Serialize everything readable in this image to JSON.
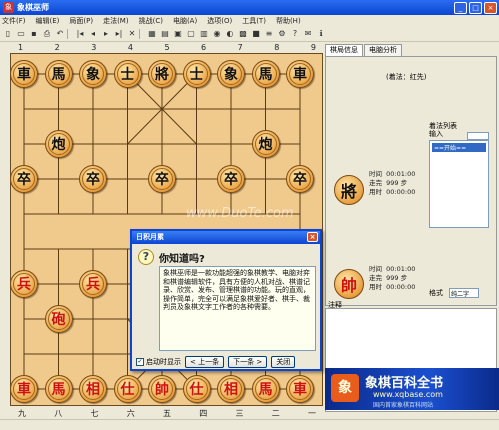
{
  "window": {
    "title": "象棋巫师"
  },
  "menu": [
    "文件(F)",
    "编辑(E)",
    "局面(P)",
    "走法(M)",
    "挑战(C)",
    "电脑(A)",
    "选项(O)",
    "工具(T)",
    "帮助(H)"
  ],
  "toolbar_icons": [
    "new-icon",
    "open-icon",
    "save-icon",
    "print-icon",
    "undo-icon",
    "first-icon",
    "prev-icon",
    "next-icon",
    "last-icon",
    "delete-icon",
    "grid-icon",
    "board-icon",
    "paste-icon",
    "copy-icon",
    "layout-icon",
    "piece-icon",
    "color-icon",
    "engine-icon",
    "stop-icon",
    "list-icon",
    "options-icon",
    "help-icon",
    "mail-icon",
    "info-icon"
  ],
  "board": {
    "top_files": [
      "1",
      "2",
      "3",
      "4",
      "5",
      "6",
      "7",
      "8",
      "9"
    ],
    "bottom_files": [
      "九",
      "八",
      "七",
      "六",
      "五",
      "四",
      "三",
      "二",
      "一"
    ],
    "pieces": [
      {
        "ch": "車",
        "side": "black",
        "col": 0,
        "row": 0
      },
      {
        "ch": "馬",
        "side": "black",
        "col": 1,
        "row": 0
      },
      {
        "ch": "象",
        "side": "black",
        "col": 2,
        "row": 0
      },
      {
        "ch": "士",
        "side": "black",
        "col": 3,
        "row": 0
      },
      {
        "ch": "將",
        "side": "black",
        "col": 4,
        "row": 0
      },
      {
        "ch": "士",
        "side": "black",
        "col": 5,
        "row": 0
      },
      {
        "ch": "象",
        "side": "black",
        "col": 6,
        "row": 0
      },
      {
        "ch": "馬",
        "side": "black",
        "col": 7,
        "row": 0
      },
      {
        "ch": "車",
        "side": "black",
        "col": 8,
        "row": 0
      },
      {
        "ch": "炮",
        "side": "black",
        "col": 1,
        "row": 2
      },
      {
        "ch": "炮",
        "side": "black",
        "col": 7,
        "row": 2
      },
      {
        "ch": "卒",
        "side": "black",
        "col": 0,
        "row": 3
      },
      {
        "ch": "卒",
        "side": "black",
        "col": 2,
        "row": 3
      },
      {
        "ch": "卒",
        "side": "black",
        "col": 4,
        "row": 3
      },
      {
        "ch": "卒",
        "side": "black",
        "col": 6,
        "row": 3
      },
      {
        "ch": "卒",
        "side": "black",
        "col": 8,
        "row": 3
      },
      {
        "ch": "兵",
        "side": "red",
        "col": 0,
        "row": 6
      },
      {
        "ch": "兵",
        "side": "red",
        "col": 2,
        "row": 6
      },
      {
        "ch": "砲",
        "side": "red",
        "col": 1,
        "row": 7
      },
      {
        "ch": "車",
        "side": "red",
        "col": 0,
        "row": 9
      },
      {
        "ch": "馬",
        "side": "red",
        "col": 1,
        "row": 9
      },
      {
        "ch": "相",
        "side": "red",
        "col": 2,
        "row": 9
      },
      {
        "ch": "仕",
        "side": "red",
        "col": 3,
        "row": 9
      },
      {
        "ch": "帥",
        "side": "red",
        "col": 4,
        "row": 9
      },
      {
        "ch": "仕",
        "side": "red",
        "col": 5,
        "row": 9
      },
      {
        "ch": "相",
        "side": "red",
        "col": 6,
        "row": 9
      },
      {
        "ch": "馬",
        "side": "red",
        "col": 7,
        "row": 9
      },
      {
        "ch": "車",
        "side": "red",
        "col": 8,
        "row": 9
      }
    ]
  },
  "panel": {
    "tabs": [
      "棋局信息",
      "电脑分析"
    ],
    "move_style": "(着法：红先)",
    "black_general": "將",
    "red_general": "帥",
    "black_time": {
      "time_label": "时间",
      "time": "00:01:00",
      "steps_label": "走完",
      "steps": "999 步",
      "used_label": "用时",
      "used": "00:00:00"
    },
    "red_time": {
      "time_label": "时间",
      "time": "00:01:00",
      "steps_label": "走完",
      "steps": "999 步",
      "used_label": "用时",
      "used": "00:00:00"
    },
    "move_list_label": "着法列表",
    "input_label": "输入",
    "move_list_selected": "==开始==",
    "format_label": "格式",
    "format_value": "纯二字",
    "comment_label": "注释"
  },
  "banner": {
    "title": "象棋百科全书",
    "url": "www.xqbase.com",
    "sub": "国内首家象棋百科网站"
  },
  "dialog": {
    "title": "日积月累",
    "heading": "你知道吗?",
    "body": "象棋巫师是一款功能超强的象棋教学、电脑对弈和棋谱编辑软件，具有方便的人机对战、棋谱记录、欣赏、发布、管理棋谱的功能。玩的直观，操作简单，完全可以满足象棋爱好者、棋手、裁判员及象棋文字工作者的各种需要。",
    "checkbox_label": "启动时显示",
    "checked": "✓",
    "prev_label": "上一条",
    "next_label": "下一条",
    "close_label": "关闭"
  },
  "watermark": "www.DuoTe.com"
}
